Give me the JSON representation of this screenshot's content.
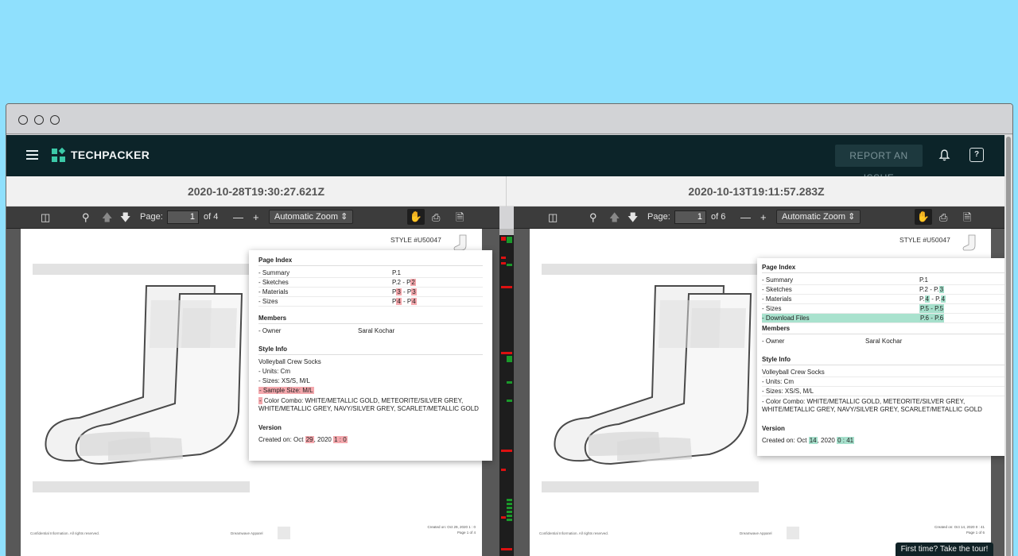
{
  "app": {
    "brand": "TECHPACKER",
    "report_label": "REPORT AN ISSUE",
    "help_glyph": "?",
    "tour_label": "First time? Take the tour!"
  },
  "left": {
    "timestamp": "2020-10-28T19:30:27.621Z",
    "toolbar": {
      "page_label": "Page:",
      "page_value": "1",
      "page_total": "of 4",
      "zoom_label": "Automatic Zoom"
    },
    "style_number": "STYLE #U50047",
    "page_index_title": "Page Index",
    "page_index": [
      {
        "label": "- Summary",
        "pages": "P.1"
      },
      {
        "label": "- Sketches",
        "pages": "P.2 - P",
        "hl": "2"
      },
      {
        "label": "- Materials",
        "pages_pre": "P",
        "hl1": "3",
        "pages_mid": " - P",
        "hl2": "3"
      },
      {
        "label": "- Sizes",
        "pages_pre": "P",
        "hl1": "4",
        "pages_mid": " - P",
        "hl2": "4"
      }
    ],
    "members_title": "Members",
    "owner_label": "- Owner",
    "owner_value": "Saral Kochar",
    "style_info_title": "Style Info",
    "style_name": "Volleyball Crew Socks",
    "units": "- Units: Cm",
    "sizes": "- Sizes: XS/S, M/L",
    "sample_size": "- Sample Size: M/L",
    "color_combo": "Color Combo: WHITE/METALLIC GOLD, METEORITE/SILVER GREY, WHITE/METALLIC GREY, NAVY/SILVER GREY, SCARLET/METALLIC GOLD",
    "version_title": "Version",
    "created_pre": "Created on: Oct ",
    "created_day": "29",
    "created_mid": ", 2020 ",
    "created_time": "1 : 0",
    "footer_left": "Confidential Information. All rights reserved.",
    "footer_mid": "Dreamwave Apparel",
    "footer_created": "Created on: Oct 29, 2020 1 : 0",
    "footer_page": "Page 1 of 4"
  },
  "right": {
    "timestamp": "2020-10-13T19:11:57.283Z",
    "toolbar": {
      "page_label": "Page:",
      "page_value": "1",
      "page_total": "of 6",
      "zoom_label": "Automatic Zoom"
    },
    "style_number": "STYLE #U50047",
    "page_index_title": "Page Index",
    "page_index": [
      {
        "label": "- Summary",
        "pages": "P.1"
      },
      {
        "label": "- Sketches",
        "pages": "P.2 - P.",
        "hl": "3"
      },
      {
        "label": "- Materials",
        "pages_pre": "P.",
        "hl1": "4",
        "pages_mid": " - P.",
        "hl2": "4"
      },
      {
        "label": "- Sizes",
        "pages_pre": "P.",
        "hl1": "5",
        "pages_mid": " - P.",
        "hl2": "5"
      },
      {
        "label": "- Download Files",
        "pages_pre": "P.",
        "hl1": "6",
        "pages_mid": " - P.",
        "hl2": "6"
      }
    ],
    "members_title": "Members",
    "owner_label": "- Owner",
    "owner_value": "Saral Kochar",
    "style_info_title": "Style Info",
    "style_name": "Volleyball Crew Socks",
    "units": "- Units: Cm",
    "sizes": "- Sizes: XS/S, M/L",
    "color_combo": "- Color Combo: WHITE/METALLIC GOLD, METEORITE/SILVER GREY, WHITE/METALLIC GREY, NAVY/SILVER GREY, SCARLET/METALLIC GOLD",
    "version_title": "Version",
    "created_pre": "Created on: Oct ",
    "created_day": "14",
    "created_mid": ", 2020 ",
    "created_time": "0 : 41",
    "footer_left": "Confidential Information. All rights reserved.",
    "footer_mid": "Dreamwave Apparel",
    "footer_created": "Created on: Oct 14, 2020 0 : 41",
    "footer_page": "Page 1 of 6"
  },
  "colors": {
    "appbar": "#0c2429",
    "accent": "#3cc9a8",
    "removed_highlight": "#f4a8ad",
    "added_highlight": "#a6e0cc"
  }
}
